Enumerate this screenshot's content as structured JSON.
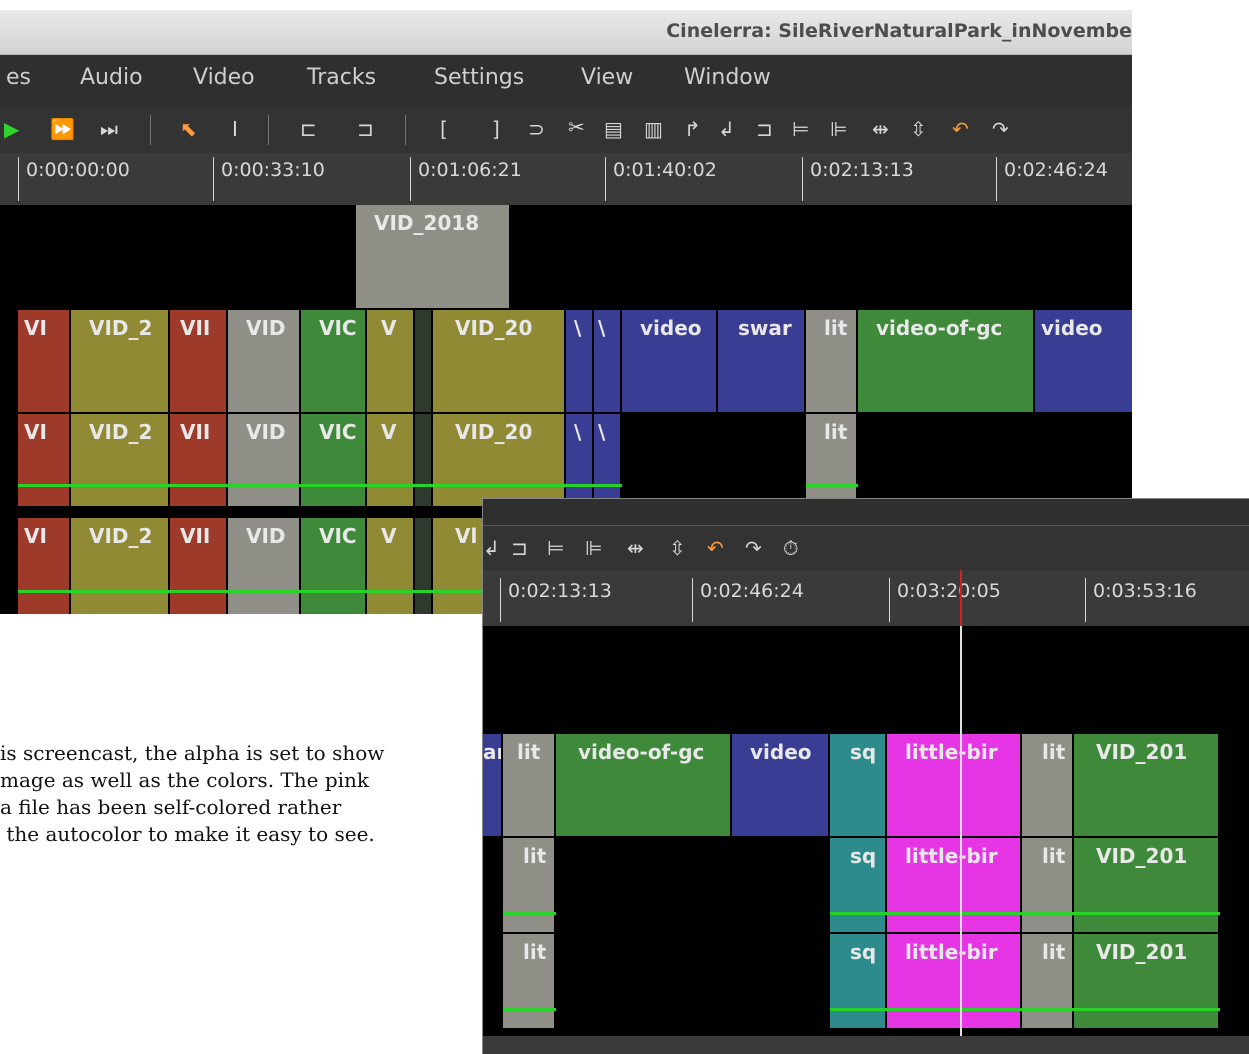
{
  "window_main": {
    "title": "Cinelerra: SileRiverNaturalPark_inNovembe",
    "menu": [
      "es",
      "Audio",
      "Video",
      "Tracks",
      "Settings",
      "View",
      "Window"
    ],
    "ruler_ticks": [
      "0:00:00:00",
      "0:00:33:10",
      "0:01:06:21",
      "0:01:40:02",
      "0:02:13:13",
      "0:02:46:24"
    ],
    "top_clip": "VID_2018",
    "video_clips": [
      "VI",
      "VID_2",
      "VII",
      "VID",
      "VIC",
      "V",
      "VID_20",
      "\\",
      "\\",
      "video",
      "swar",
      "lit",
      "video-of-gc",
      "video"
    ],
    "audio1_clips": [
      "VI",
      "VID_2",
      "VII",
      "VID",
      "VIC",
      "V",
      "VID_20",
      "\\",
      "\\",
      "lit"
    ],
    "audio2_clips": [
      "VI",
      "VID_2",
      "VII",
      "VID",
      "VIC",
      "V",
      "Vl"
    ]
  },
  "window_zoom": {
    "ruler_ticks": [
      "0:02:13:13",
      "0:02:46:24",
      "0:03:20:05",
      "0:03:53:16"
    ],
    "video_clips": [
      "ar",
      "lit",
      "video-of-gc",
      "video",
      "sq",
      "little-bir",
      "lit",
      "VID_201"
    ],
    "audio1_clips": [
      "lit",
      "sq",
      "little-bir",
      "lit",
      "VID_201"
    ],
    "audio2_clips": [
      "lit",
      "sq",
      "little-bir",
      "lit",
      "VID_201"
    ]
  },
  "caption": {
    "lines": [
      "is screencast, the alpha is set to show",
      "mage as well as the colors.  The pink",
      "a file has been self-colored rather",
      " the autocolor to make it easy to see."
    ]
  },
  "colors": {
    "red": "#9e3a2a",
    "olive": "#8f8a33",
    "grey": "#8f8f88",
    "green": "#3f8a3a",
    "blue": "#3a3d94",
    "magenta": "#e535e5",
    "teal": "#2d8b8b",
    "audio_line": "#26d326"
  }
}
